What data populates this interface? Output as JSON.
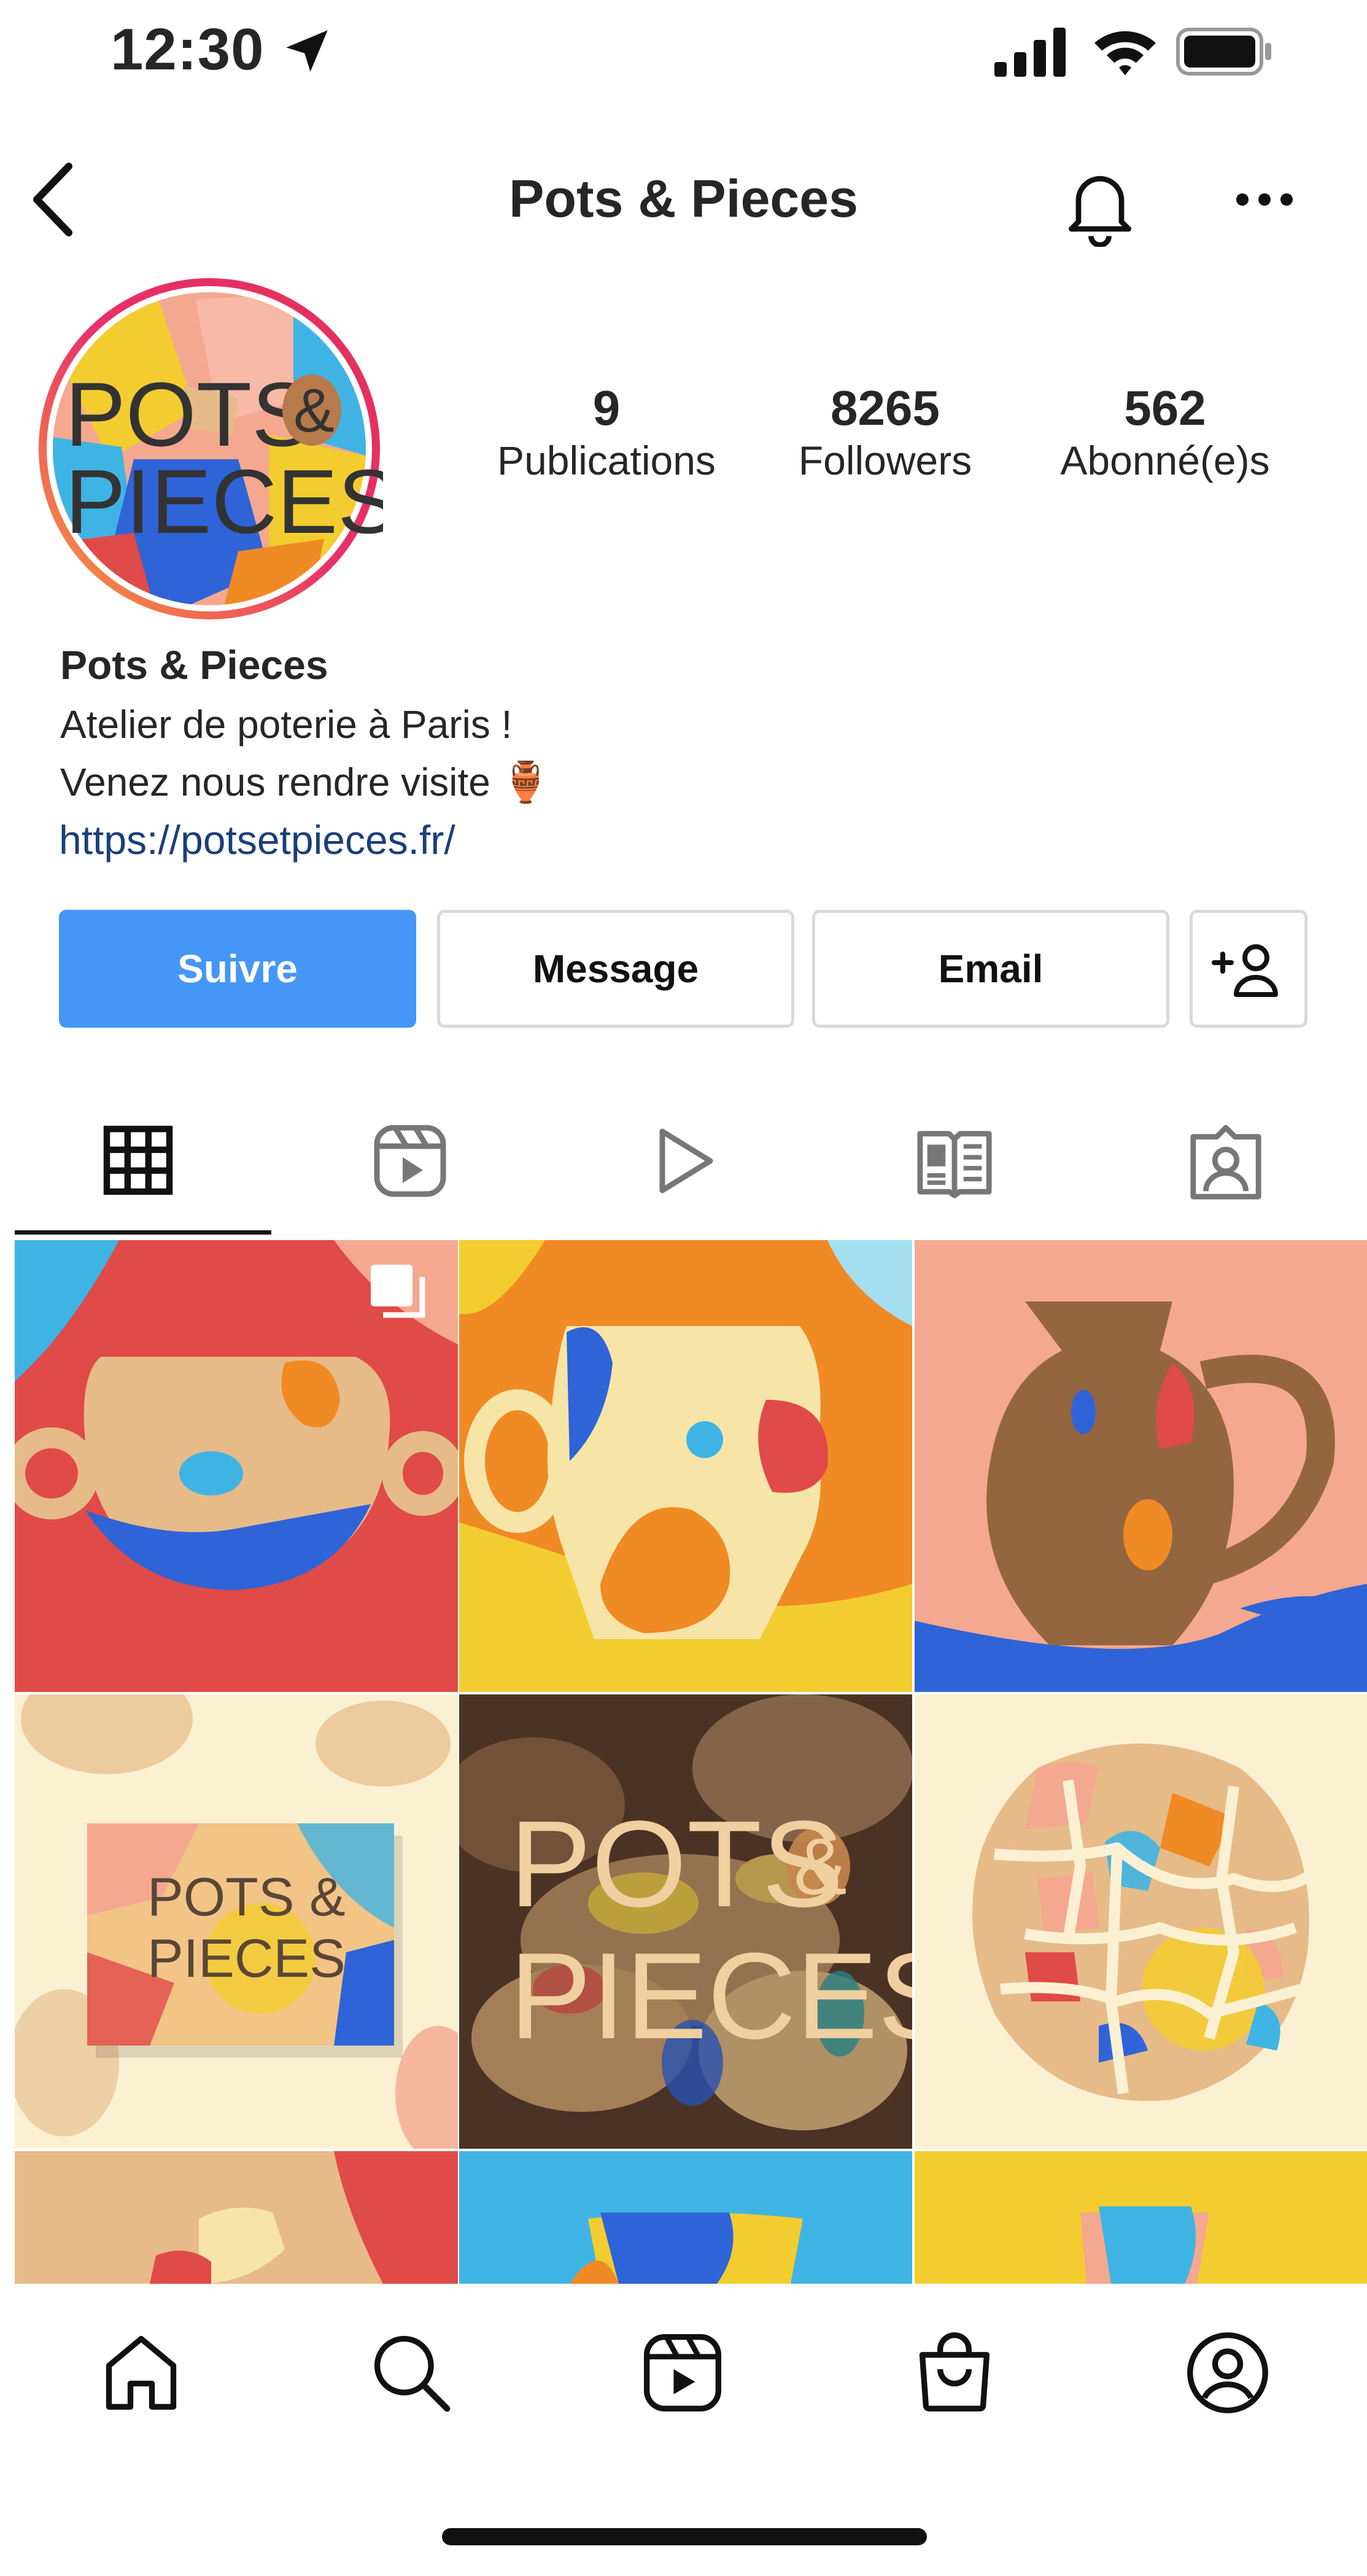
{
  "status_bar": {
    "time": "12:30"
  },
  "header": {
    "title": "Pots & Pieces"
  },
  "profile": {
    "avatar_text_line1": "POTS",
    "avatar_text_amp": "&",
    "avatar_text_line2": "PIECES",
    "stats": [
      {
        "value": "9",
        "label": "Publications"
      },
      {
        "value": "8265",
        "label": "Followers"
      },
      {
        "value": "562",
        "label": "Abonné(e)s"
      }
    ],
    "name": "Pots & Pieces",
    "bio_line1": "Atelier de poterie à Paris !",
    "bio_line2": "Venez nous rendre visite 🏺",
    "link": "https://potsetpieces.fr/"
  },
  "actions": {
    "follow": "Suivre",
    "message": "Message",
    "email": "Email"
  },
  "posts": {
    "box_text_line1": "POTS &",
    "box_text_line2": "PIECES",
    "photo_text_line1": "POTS",
    "photo_text_amp": "&",
    "photo_text_line2": "PIECES"
  },
  "colors": {
    "red": "#e04a48",
    "orange": "#f08a24",
    "yellow": "#f3cd2f",
    "blue": "#2f63d8",
    "cyan": "#3fb4e4",
    "peach": "#f4a88f",
    "tan": "#e6bb88",
    "brown": "#946640",
    "cream": "#fbf1d2",
    "follow_blue": "#4596f7"
  }
}
